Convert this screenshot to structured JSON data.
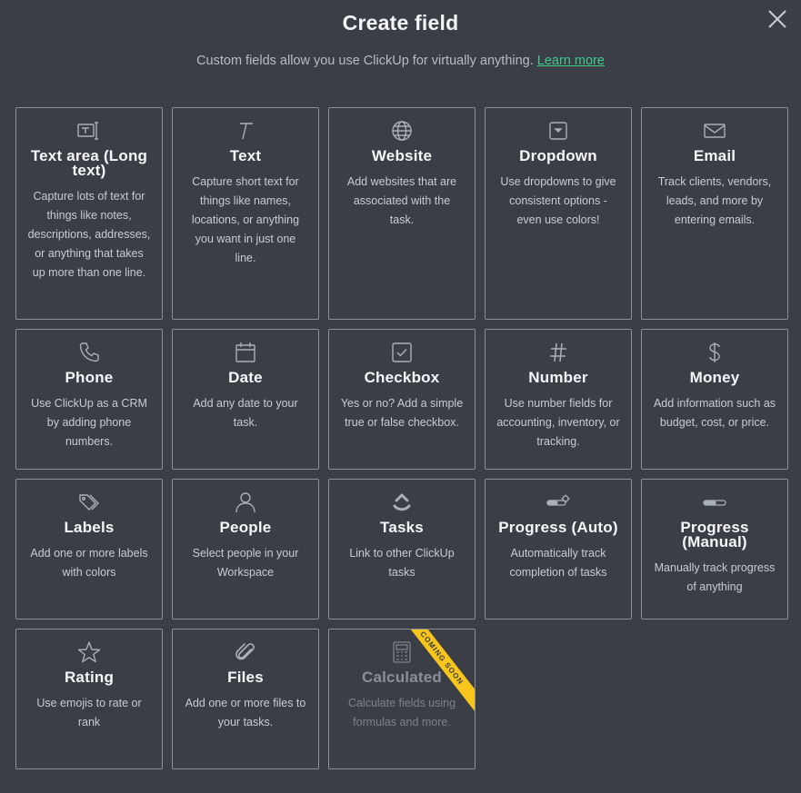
{
  "header": {
    "title": "Create field",
    "subtitle": "Custom fields allow you use ClickUp for virtually anything.",
    "learn_more": "Learn more"
  },
  "colors": {
    "accent": "#3fc98a",
    "ribbon": "#f7c51c",
    "background": "#3b3f45"
  },
  "fields": [
    {
      "name": "Text area (Long text)",
      "desc": "Capture lots of text for things like notes, descriptions, addresses, or anything that takes up more than one line.",
      "icon": "text-area-icon"
    },
    {
      "name": "Text",
      "desc": "Capture short text for things like names, locations, or anything you want in just one line.",
      "icon": "text-icon"
    },
    {
      "name": "Website",
      "desc": "Add websites that are associated with the task.",
      "icon": "globe-icon"
    },
    {
      "name": "Dropdown",
      "desc": "Use dropdowns to give consistent options - even use colors!",
      "icon": "dropdown-icon"
    },
    {
      "name": "Email",
      "desc": "Track clients, vendors, leads, and more by entering emails.",
      "icon": "envelope-icon"
    },
    {
      "name": "Phone",
      "desc": "Use ClickUp as a CRM by adding phone numbers.",
      "icon": "phone-icon"
    },
    {
      "name": "Date",
      "desc": "Add any date to your task.",
      "icon": "calendar-icon"
    },
    {
      "name": "Checkbox",
      "desc": "Yes or no? Add a simple true or false checkbox.",
      "icon": "checkbox-icon"
    },
    {
      "name": "Number",
      "desc": "Use number fields for accounting, inventory, or tracking.",
      "icon": "hash-icon"
    },
    {
      "name": "Money",
      "desc": "Add information such as budget, cost, or price.",
      "icon": "dollar-icon"
    },
    {
      "name": "Labels",
      "desc": "Add one or more labels with colors",
      "icon": "tags-icon"
    },
    {
      "name": "People",
      "desc": "Select people in your Workspace",
      "icon": "person-icon"
    },
    {
      "name": "Tasks",
      "desc": "Link to other ClickUp tasks",
      "icon": "clickup-icon"
    },
    {
      "name": "Progress (Auto)",
      "desc": "Automatically track completion of tasks",
      "icon": "progress-auto-icon"
    },
    {
      "name": "Progress (Manual)",
      "desc": "Manually track progress of anything",
      "icon": "progress-manual-icon"
    },
    {
      "name": "Rating",
      "desc": "Use emojis to rate or rank",
      "icon": "star-icon"
    },
    {
      "name": "Files",
      "desc": "Add one or more files to your tasks.",
      "icon": "paperclip-icon"
    },
    {
      "name": "Calculated",
      "desc": "Calculate fields using formulas and more.",
      "icon": "calculator-icon",
      "badge": "COMING SOON"
    }
  ]
}
